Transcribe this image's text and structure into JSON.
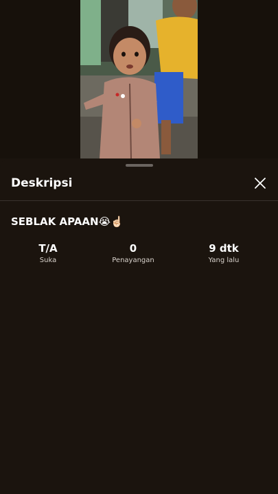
{
  "sheet": {
    "title": "Deskripsi"
  },
  "description": {
    "text": "SEBLAK APAAN😭☝🏻"
  },
  "stats": [
    {
      "value": "T/A",
      "label": "Suka"
    },
    {
      "value": "0",
      "label": "Penayangan"
    },
    {
      "value": "9 dtk",
      "label": "Yang lalu"
    }
  ],
  "icons": {
    "close": "close-icon"
  },
  "colors": {
    "background": "#1b140e",
    "text": "#ffffff",
    "secondary_text": "#d8d2cc",
    "divider": "#3a342f"
  }
}
